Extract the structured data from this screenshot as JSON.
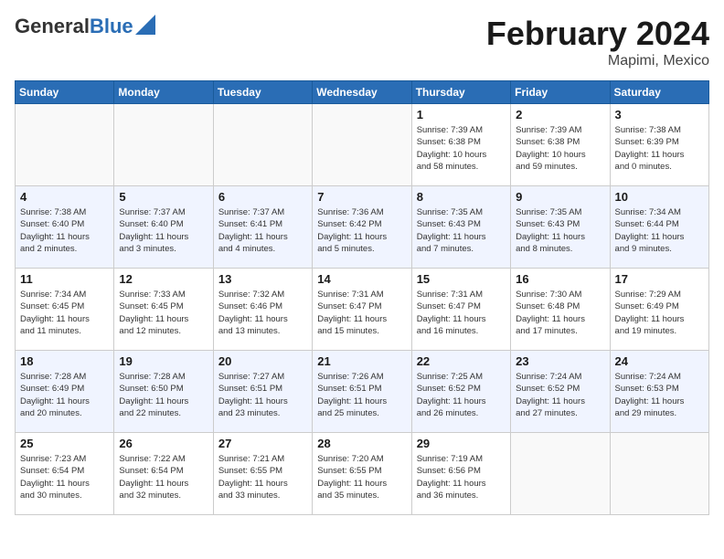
{
  "header": {
    "logo_general": "General",
    "logo_blue": "Blue",
    "month_title": "February 2024",
    "location": "Mapimi, Mexico"
  },
  "days_of_week": [
    "Sunday",
    "Monday",
    "Tuesday",
    "Wednesday",
    "Thursday",
    "Friday",
    "Saturday"
  ],
  "weeks": [
    [
      {
        "day": "",
        "info": ""
      },
      {
        "day": "",
        "info": ""
      },
      {
        "day": "",
        "info": ""
      },
      {
        "day": "",
        "info": ""
      },
      {
        "day": "1",
        "info": "Sunrise: 7:39 AM\nSunset: 6:38 PM\nDaylight: 10 hours\nand 58 minutes."
      },
      {
        "day": "2",
        "info": "Sunrise: 7:39 AM\nSunset: 6:38 PM\nDaylight: 10 hours\nand 59 minutes."
      },
      {
        "day": "3",
        "info": "Sunrise: 7:38 AM\nSunset: 6:39 PM\nDaylight: 11 hours\nand 0 minutes."
      }
    ],
    [
      {
        "day": "4",
        "info": "Sunrise: 7:38 AM\nSunset: 6:40 PM\nDaylight: 11 hours\nand 2 minutes."
      },
      {
        "day": "5",
        "info": "Sunrise: 7:37 AM\nSunset: 6:40 PM\nDaylight: 11 hours\nand 3 minutes."
      },
      {
        "day": "6",
        "info": "Sunrise: 7:37 AM\nSunset: 6:41 PM\nDaylight: 11 hours\nand 4 minutes."
      },
      {
        "day": "7",
        "info": "Sunrise: 7:36 AM\nSunset: 6:42 PM\nDaylight: 11 hours\nand 5 minutes."
      },
      {
        "day": "8",
        "info": "Sunrise: 7:35 AM\nSunset: 6:43 PM\nDaylight: 11 hours\nand 7 minutes."
      },
      {
        "day": "9",
        "info": "Sunrise: 7:35 AM\nSunset: 6:43 PM\nDaylight: 11 hours\nand 8 minutes."
      },
      {
        "day": "10",
        "info": "Sunrise: 7:34 AM\nSunset: 6:44 PM\nDaylight: 11 hours\nand 9 minutes."
      }
    ],
    [
      {
        "day": "11",
        "info": "Sunrise: 7:34 AM\nSunset: 6:45 PM\nDaylight: 11 hours\nand 11 minutes."
      },
      {
        "day": "12",
        "info": "Sunrise: 7:33 AM\nSunset: 6:45 PM\nDaylight: 11 hours\nand 12 minutes."
      },
      {
        "day": "13",
        "info": "Sunrise: 7:32 AM\nSunset: 6:46 PM\nDaylight: 11 hours\nand 13 minutes."
      },
      {
        "day": "14",
        "info": "Sunrise: 7:31 AM\nSunset: 6:47 PM\nDaylight: 11 hours\nand 15 minutes."
      },
      {
        "day": "15",
        "info": "Sunrise: 7:31 AM\nSunset: 6:47 PM\nDaylight: 11 hours\nand 16 minutes."
      },
      {
        "day": "16",
        "info": "Sunrise: 7:30 AM\nSunset: 6:48 PM\nDaylight: 11 hours\nand 17 minutes."
      },
      {
        "day": "17",
        "info": "Sunrise: 7:29 AM\nSunset: 6:49 PM\nDaylight: 11 hours\nand 19 minutes."
      }
    ],
    [
      {
        "day": "18",
        "info": "Sunrise: 7:28 AM\nSunset: 6:49 PM\nDaylight: 11 hours\nand 20 minutes."
      },
      {
        "day": "19",
        "info": "Sunrise: 7:28 AM\nSunset: 6:50 PM\nDaylight: 11 hours\nand 22 minutes."
      },
      {
        "day": "20",
        "info": "Sunrise: 7:27 AM\nSunset: 6:51 PM\nDaylight: 11 hours\nand 23 minutes."
      },
      {
        "day": "21",
        "info": "Sunrise: 7:26 AM\nSunset: 6:51 PM\nDaylight: 11 hours\nand 25 minutes."
      },
      {
        "day": "22",
        "info": "Sunrise: 7:25 AM\nSunset: 6:52 PM\nDaylight: 11 hours\nand 26 minutes."
      },
      {
        "day": "23",
        "info": "Sunrise: 7:24 AM\nSunset: 6:52 PM\nDaylight: 11 hours\nand 27 minutes."
      },
      {
        "day": "24",
        "info": "Sunrise: 7:24 AM\nSunset: 6:53 PM\nDaylight: 11 hours\nand 29 minutes."
      }
    ],
    [
      {
        "day": "25",
        "info": "Sunrise: 7:23 AM\nSunset: 6:54 PM\nDaylight: 11 hours\nand 30 minutes."
      },
      {
        "day": "26",
        "info": "Sunrise: 7:22 AM\nSunset: 6:54 PM\nDaylight: 11 hours\nand 32 minutes."
      },
      {
        "day": "27",
        "info": "Sunrise: 7:21 AM\nSunset: 6:55 PM\nDaylight: 11 hours\nand 33 minutes."
      },
      {
        "day": "28",
        "info": "Sunrise: 7:20 AM\nSunset: 6:55 PM\nDaylight: 11 hours\nand 35 minutes."
      },
      {
        "day": "29",
        "info": "Sunrise: 7:19 AM\nSunset: 6:56 PM\nDaylight: 11 hours\nand 36 minutes."
      },
      {
        "day": "",
        "info": ""
      },
      {
        "day": "",
        "info": ""
      }
    ]
  ]
}
